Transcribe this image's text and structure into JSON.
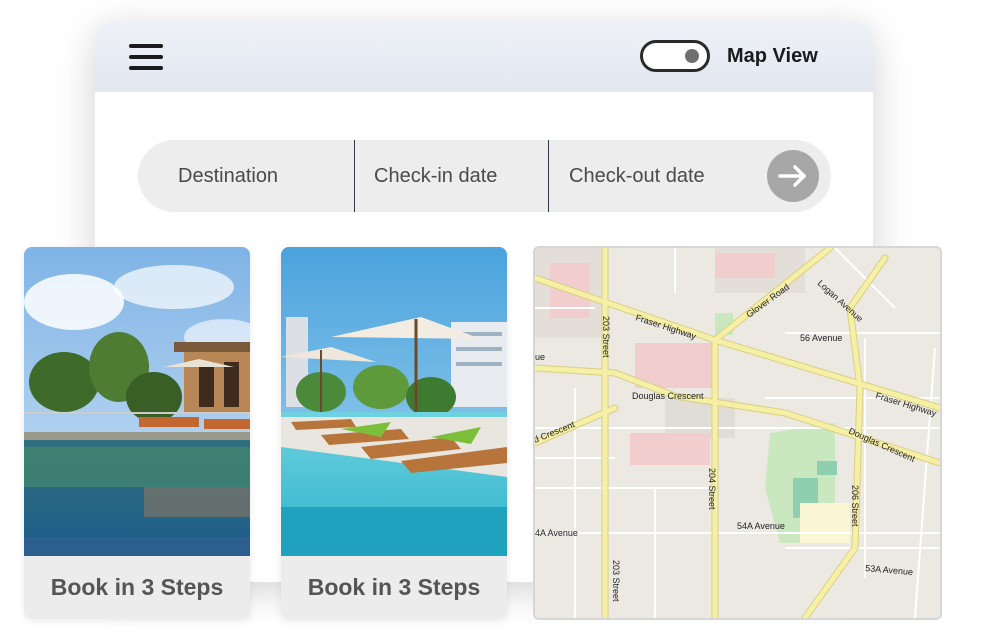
{
  "header": {
    "menu_icon": "hamburger-menu-icon",
    "toggle_state": "on",
    "map_view_label": "Map View"
  },
  "search": {
    "destination_placeholder": "Destination",
    "checkin_placeholder": "Check-in date",
    "checkout_placeholder": "Check-out date",
    "submit_icon": "arrow-right-icon"
  },
  "cards": [
    {
      "label": "Book in 3 Steps",
      "image": "resort-pool-with-pavilion"
    },
    {
      "label": "Book in 3 Steps",
      "image": "pool-with-umbrellas-and-loungers"
    }
  ],
  "map": {
    "labels": {
      "fraser_highway_w": "Fraser Highway",
      "fraser_highway_e": "Fraser Highway",
      "glover_road": "Glover Road",
      "logan_avenue": "Logan Avenue",
      "ave_56": "56 Avenue",
      "street_203_n": "203 Street",
      "street_203_s": "203 Street",
      "douglas_crescent_mid": "Douglas Crescent",
      "douglas_crescent_w": "d Crescent",
      "douglas_crescent_e": "Douglas Crescent",
      "street_204": "204 Street",
      "street_206": "206 Street",
      "ave_54a_w": "4A Avenue",
      "ave_54a_e": "54A Avenue",
      "ave_53a": "53A Avenue",
      "ave_w_fragment": "ue"
    }
  },
  "colors": {
    "header_bg": "#e6eaf2",
    "search_bg": "#ededed",
    "button_gray": "#a7a7a7",
    "map_major_road": "#f6f0a6",
    "map_park": "#c9e8c0",
    "map_commercial": "#f2cdcd"
  }
}
